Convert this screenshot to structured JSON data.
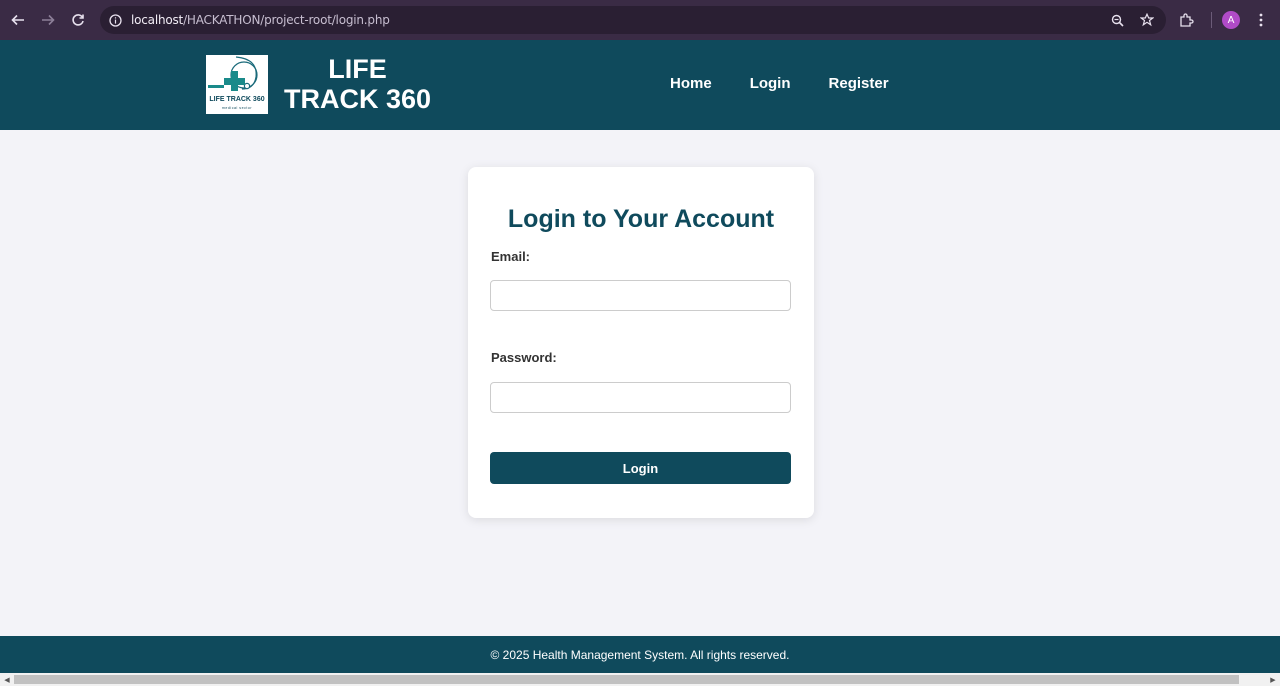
{
  "browser": {
    "url_host": "localhost",
    "url_path": "/HACKATHON/project-root/login.php",
    "profile_initial": "A"
  },
  "header": {
    "brand_line1": "LIFE",
    "brand_line2": "TRACK 360",
    "logo_text": "LIFE TRACK 360",
    "logo_subtext": "medical sector",
    "nav": [
      "Home",
      "Login",
      "Register"
    ]
  },
  "login": {
    "title": "Login to Your Account",
    "email_label": "Email:",
    "email_value": "",
    "password_label": "Password:",
    "password_value": "",
    "submit_label": "Login"
  },
  "footer": {
    "text": "© 2025 Health Management System. All rights reserved."
  },
  "colors": {
    "primary": "#0f4a5c",
    "background": "#f3f3f8",
    "logo_teal": "#1a8a8a"
  }
}
